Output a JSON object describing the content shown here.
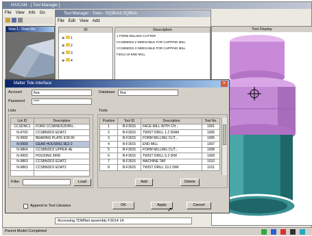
{
  "main_window": {
    "title": "NX/CAM - [ Tool Manager ]",
    "menu": [
      "File",
      "View",
      "Info",
      "Go"
    ]
  },
  "tool_manager": {
    "title": "Tool Manager - Tools - SQ9DA3.SQ9DA",
    "menu": [
      "File",
      "Edit",
      "View",
      "Add"
    ],
    "tree_header": "ID",
    "desc_header": "Description",
    "descriptions": [
      "1 FORM MILLING CUTTER",
      "CCSBNDD2 2 INDEXABLE FOR CUPPING MILL",
      "CCSBNDD2 3 INDEXABLE FOR CUPPING MILL",
      "F3014 19 END MILL"
    ],
    "tree_items": [
      "1",
      "2",
      "3",
      "4"
    ]
  },
  "tool_display": {
    "title": "Tool Display"
  },
  "left_panel": {
    "title": "View 1 - Draw Mo"
  },
  "dialog": {
    "title": "Matter Tide Interface",
    "account_label": "Account",
    "account_value": "fiva",
    "database_label": "Database",
    "database_value": "fiva",
    "password_label": "Password",
    "password_value": "****",
    "lists_label": "Lists",
    "tools_label": "Tools",
    "lists_headers": [
      "List ID",
      "Description"
    ],
    "lists_rows": [
      [
        "CCSDNC1",
        "FORD CCSBNDD2DRN..."
      ],
      [
        "N-9792",
        "CCSBNDD2 EDAT2"
      ],
      [
        "N-9992",
        "BEARING PLATE E39 90"
      ],
      [
        "N-9993",
        "GEAR HOUSING 9E2-2"
      ],
      [
        "N-9864",
        "CCSBNDD2 UPPER 4E"
      ],
      [
        "N-9993",
        "HOUSING 9998"
      ],
      [
        "N-9863",
        "CCSBNDD2 EDAT2"
      ],
      [
        "N-9863",
        "CCSBNDD2 EDAT2"
      ]
    ],
    "tools_headers": [
      "Position",
      "Tool ID",
      "Description",
      "Tool No."
    ],
    "tools_rows": [
      [
        "1",
        "B-F3015",
        "FACE MILL WITH CH...",
        "1001"
      ],
      [
        "2",
        "B-F3015",
        "TWIST DRILL 1.2 DIAM",
        "1005"
      ],
      [
        "3",
        "B-F3015",
        "FORM MILLING CUT...",
        "1006"
      ],
      [
        "4",
        "B-F3015",
        "END MILL",
        "1007"
      ],
      [
        "5",
        "B-F3015",
        "FORM MILLING CUT...",
        "1008"
      ],
      [
        "6",
        "B-F3015",
        "TWIST DRILL 5.3 DIM",
        "1009"
      ],
      [
        "7",
        "B-F3015",
        "MACHINE TAP",
        "1010"
      ],
      [
        "8",
        "B-F3015",
        "TWIST DRILL 10.2 DIM",
        "1011"
      ],
      [
        "",
        "",
        "",
        ""
      ]
    ],
    "filter_label": "Filter",
    "load_button": "Load",
    "add_button": "Add",
    "delete_button": "Delete",
    "append_label": "Append to Tool Libraries",
    "ok_button": "OK",
    "apply_button": "Apply",
    "cancel_button": "Cancel"
  },
  "status": {
    "message": "Accessing TDMNet assembly F3014 14",
    "bottom": "Parent Model Completed"
  },
  "colors": {
    "titlebar": "#0a246a",
    "part_pink": "#c88ad8",
    "part_teal": "#2c8a8c",
    "viewport_bg": "#ffffff",
    "dialog_bg": "#d4d0c8"
  }
}
